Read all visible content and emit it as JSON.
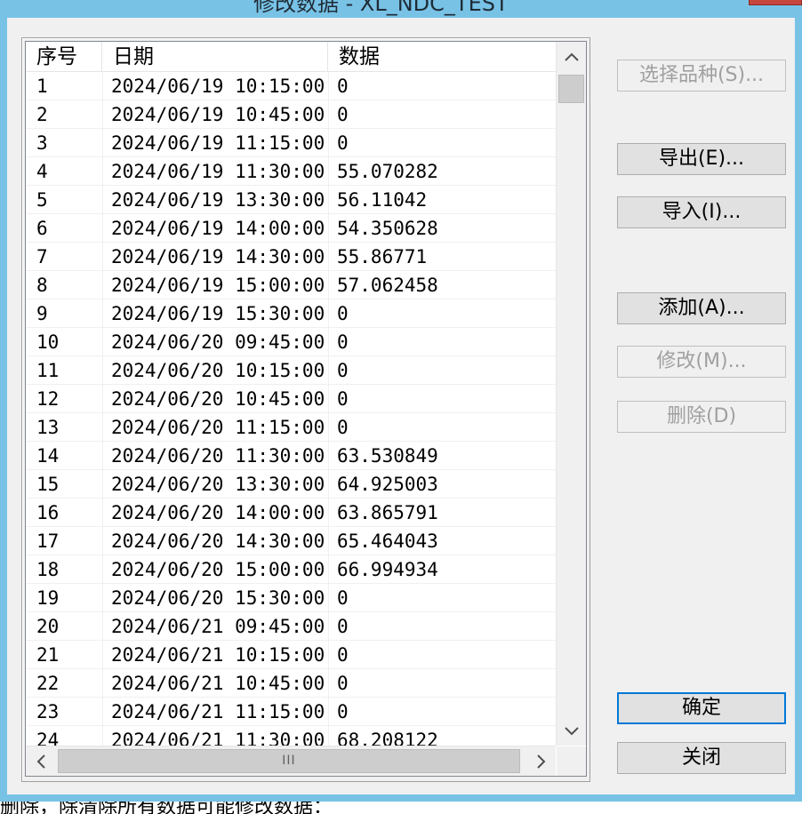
{
  "window": {
    "title": "修改数据 - XL_NDC_TEST",
    "close_icon": "close-icon"
  },
  "list": {
    "columns": [
      "序号",
      "日期",
      "数据"
    ],
    "rows": [
      [
        "1",
        "2024/06/19 10:15:00",
        "0"
      ],
      [
        "2",
        "2024/06/19 10:45:00",
        "0"
      ],
      [
        "3",
        "2024/06/19 11:15:00",
        "0"
      ],
      [
        "4",
        "2024/06/19 11:30:00",
        "55.070282"
      ],
      [
        "5",
        "2024/06/19 13:30:00",
        "56.11042"
      ],
      [
        "6",
        "2024/06/19 14:00:00",
        "54.350628"
      ],
      [
        "7",
        "2024/06/19 14:30:00",
        "55.86771"
      ],
      [
        "8",
        "2024/06/19 15:00:00",
        "57.062458"
      ],
      [
        "9",
        "2024/06/19 15:30:00",
        "0"
      ],
      [
        "10",
        "2024/06/20 09:45:00",
        "0"
      ],
      [
        "11",
        "2024/06/20 10:15:00",
        "0"
      ],
      [
        "12",
        "2024/06/20 10:45:00",
        "0"
      ],
      [
        "13",
        "2024/06/20 11:15:00",
        "0"
      ],
      [
        "14",
        "2024/06/20 11:30:00",
        "63.530849"
      ],
      [
        "15",
        "2024/06/20 13:30:00",
        "64.925003"
      ],
      [
        "16",
        "2024/06/20 14:00:00",
        "63.865791"
      ],
      [
        "17",
        "2024/06/20 14:30:00",
        "65.464043"
      ],
      [
        "18",
        "2024/06/20 15:00:00",
        "66.994934"
      ],
      [
        "19",
        "2024/06/20 15:30:00",
        "0"
      ],
      [
        "20",
        "2024/06/21 09:45:00",
        "0"
      ],
      [
        "21",
        "2024/06/21 10:15:00",
        "0"
      ],
      [
        "22",
        "2024/06/21 10:45:00",
        "0"
      ],
      [
        "23",
        "2024/06/21 11:15:00",
        "0"
      ],
      [
        "24",
        "2024/06/21 11:30:00",
        "68.208122"
      ]
    ],
    "scroll_up_icon": "chevron-up-icon",
    "scroll_down_icon": "chevron-down-icon",
    "scroll_left_icon": "chevron-left-icon",
    "scroll_right_icon": "chevron-right-icon",
    "hthumb_grip": "III"
  },
  "buttons": {
    "select_variety": "选择品种(S)...",
    "export": "导出(E)...",
    "import": "导入(I)...",
    "add": "添加(A)...",
    "modify": "修改(M)...",
    "delete": "删除(D)",
    "ok": "确定",
    "close": "关闭"
  },
  "status": {
    "text": "删除，除清除所有数据可能修改数据："
  }
}
